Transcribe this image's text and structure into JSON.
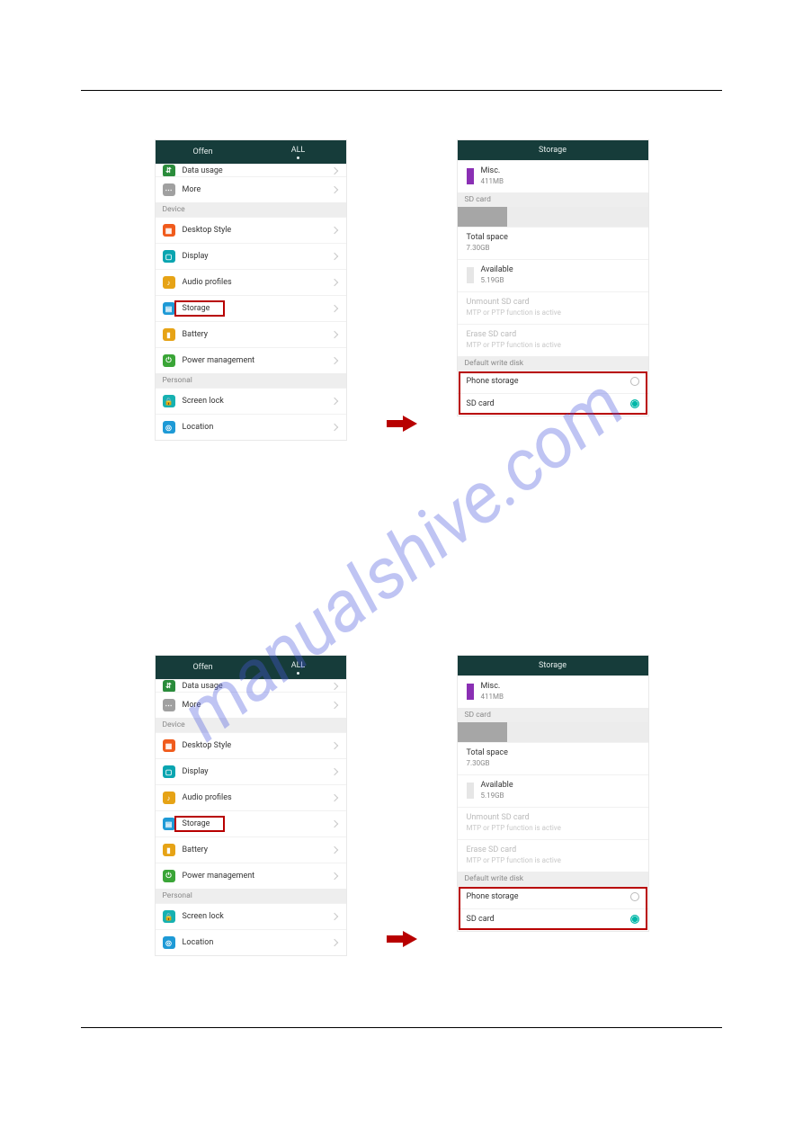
{
  "watermark_text": "manualshive.com",
  "settings_screen": {
    "tabs": {
      "offen": "Offen",
      "all": "ALL"
    },
    "truncated_top_item": "Data usage",
    "items": {
      "more": "More",
      "device_hdr": "Device",
      "desktop_style": "Desktop Style",
      "display": "Display",
      "audio_profiles": "Audio profiles",
      "storage": "Storage",
      "battery": "Battery",
      "power_mgmt": "Power management",
      "personal_hdr": "Personal",
      "screen_lock": "Screen lock",
      "location": "Location"
    }
  },
  "storage_screen": {
    "title": "Storage",
    "misc_label": "Misc.",
    "misc_value": "411MB",
    "sd_card_hdr": "SD card",
    "total_space_label": "Total space",
    "total_space_value": "7.30GB",
    "available_label": "Available",
    "available_value": "5.19GB",
    "unmount_label": "Unmount SD card",
    "unmount_sub": "MTP or PTP function is active",
    "erase_label": "Erase SD card",
    "erase_sub": "MTP or PTP function is active",
    "default_disk_hdr": "Default write disk",
    "option_phone": "Phone storage",
    "option_sd": "SD card",
    "colors": {
      "misc_swatch": "#8a2fb4",
      "available_swatch": "#e6e6e6"
    },
    "bar_used_pct": 26
  }
}
